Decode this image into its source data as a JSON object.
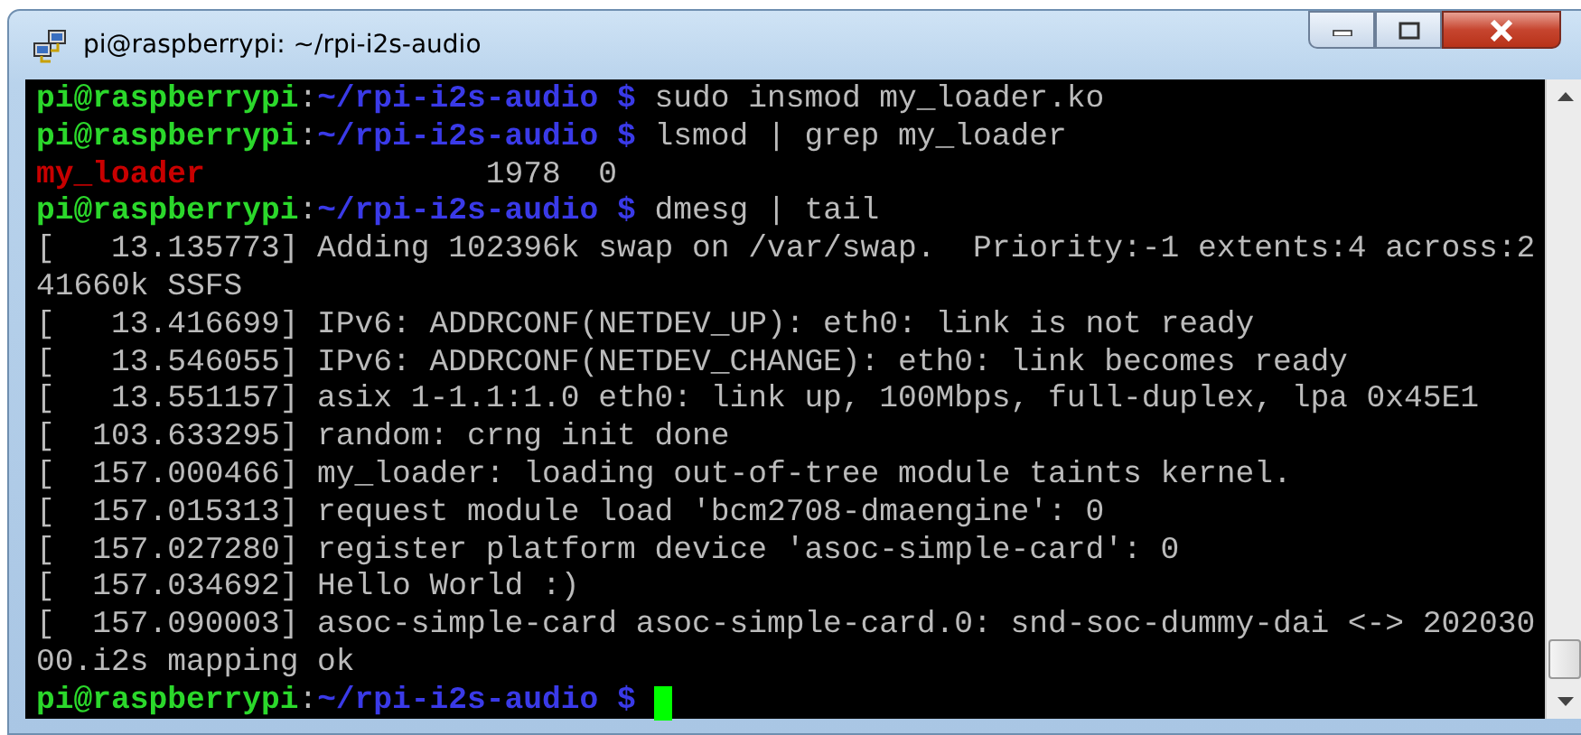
{
  "window": {
    "title": "pi@raspberrypi: ~/rpi-i2s-audio"
  },
  "terminal": {
    "lines": [
      {
        "kind": "prompt",
        "user": "pi@raspberrypi",
        "separator": ":",
        "path": "~/rpi-i2s-audio $",
        "command": "sudo insmod my_loader.ko"
      },
      {
        "kind": "prompt",
        "user": "pi@raspberrypi",
        "separator": ":",
        "path": "~/rpi-i2s-audio $",
        "command": "lsmod | grep my_loader"
      },
      {
        "kind": "module",
        "name": "my_loader",
        "info": "1978  0"
      },
      {
        "kind": "prompt",
        "user": "pi@raspberrypi",
        "separator": ":",
        "path": "~/rpi-i2s-audio $",
        "command": "dmesg | tail"
      },
      {
        "kind": "output",
        "text": "[   13.135773] Adding 102396k swap on /var/swap.  Priority:-1 extents:4 across:2"
      },
      {
        "kind": "output",
        "text": "41660k SSFS"
      },
      {
        "kind": "output",
        "text": "[   13.416699] IPv6: ADDRCONF(NETDEV_UP): eth0: link is not ready"
      },
      {
        "kind": "output",
        "text": "[   13.546055] IPv6: ADDRCONF(NETDEV_CHANGE): eth0: link becomes ready"
      },
      {
        "kind": "output",
        "text": "[   13.551157] asix 1-1.1:1.0 eth0: link up, 100Mbps, full-duplex, lpa 0x45E1"
      },
      {
        "kind": "output",
        "text": "[  103.633295] random: crng init done"
      },
      {
        "kind": "output",
        "text": "[  157.000466] my_loader: loading out-of-tree module taints kernel."
      },
      {
        "kind": "output",
        "text": "[  157.015313] request module load 'bcm2708-dmaengine': 0"
      },
      {
        "kind": "output",
        "text": "[  157.027280] register platform device 'asoc-simple-card': 0"
      },
      {
        "kind": "output",
        "text": "[  157.034692] Hello World :)"
      },
      {
        "kind": "output",
        "text": "[  157.090003] asoc-simple-card asoc-simple-card.0: snd-soc-dummy-dai <-> 202030"
      },
      {
        "kind": "output",
        "text": "00.i2s mapping ok"
      },
      {
        "kind": "prompt",
        "user": "pi@raspberrypi",
        "separator": ":",
        "path": "~/rpi-i2s-audio $",
        "cursor": true
      }
    ]
  }
}
